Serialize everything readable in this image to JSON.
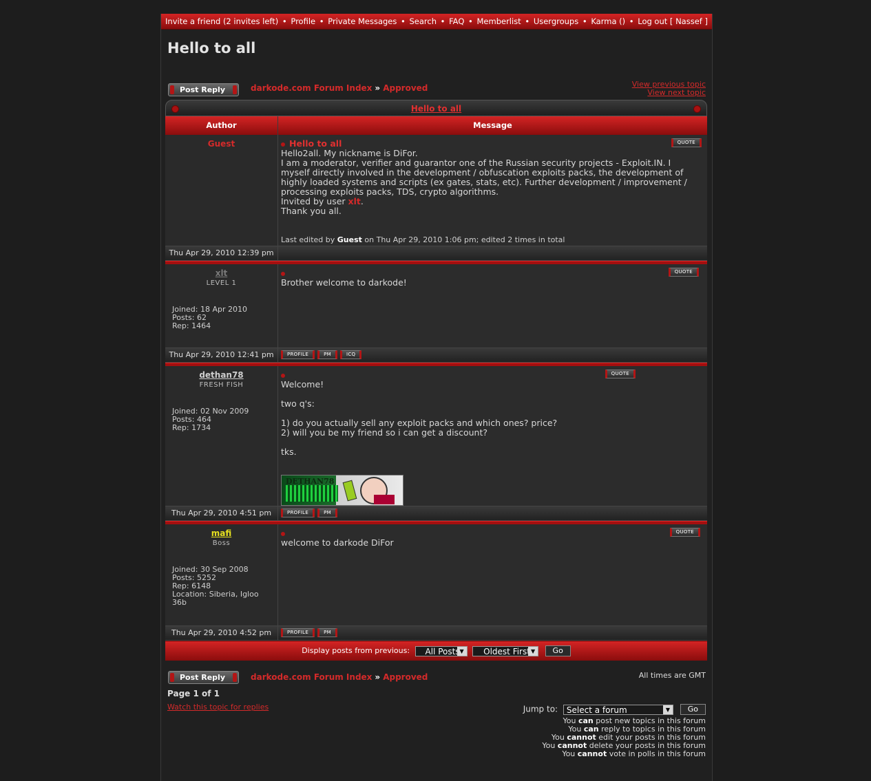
{
  "topnav": {
    "items": [
      "Invite a friend (2 invites left)",
      "Profile",
      "Private Messages",
      "Search",
      "FAQ",
      "Memberlist",
      "Usergroups",
      "Karma ()",
      "Log out"
    ],
    "separator": "•",
    "user": "[ Nassef ]"
  },
  "page_title": "Hello to all",
  "post_reply_label": "Post Reply",
  "breadcrumb": {
    "forum_index": "darkode.com Forum Index",
    "separator": "»",
    "forum": "Approved"
  },
  "topic_nav": {
    "prev": "View previous topic",
    "next": "View next topic"
  },
  "table": {
    "topic_title": "Hello to all",
    "col_author": "Author",
    "col_message": "Message"
  },
  "buttons": {
    "quote": "QUOTE",
    "profile": "PROFILE",
    "pm": "PM",
    "icq": "ICQ"
  },
  "posts": [
    {
      "author": "Guest",
      "author_color": "#d42a2a",
      "subject": "Hello to all",
      "body_lines": [
        "Hello2all. My nickname is DiFor.",
        "I am a moderator, verifier and guarantor one of the Russian security projects - Exploit.IN. I",
        "myself directly involved in the development / obfuscation exploits packs, the development of",
        "highly loaded systems and scripts (ex gates, stats, etc). Further development / improvement /",
        "processing exploits packs, TDS, crypto algorithms."
      ],
      "invited_prefix": "Invited by user ",
      "invited_user": "xlt",
      "invited_suffix": ".",
      "thanks": "Thank you all.",
      "edited_prefix": "Last edited by ",
      "edited_user": "Guest",
      "edited_suffix": " on Thu Apr 29, 2010 1:06 pm; edited 2 times in total",
      "date": "Thu Apr 29, 2010 12:39 pm"
    },
    {
      "author": "xlt",
      "author_color": "#7a7a7a",
      "rank": "LEVEL 1",
      "joined": "Joined: 18 Apr 2010",
      "posts": "Posts: 62",
      "rep": "Rep: 1464",
      "body": "Brother welcome to darkode!",
      "date": "Thu Apr 29, 2010 12:41 pm"
    },
    {
      "author": "dethan78",
      "author_color": "#cfcfcf",
      "rank": "FRESH FISH",
      "joined": "Joined: 02 Nov 2009",
      "posts": "Posts: 464",
      "rep": "Rep: 1734",
      "body_lines": [
        "Welcome!",
        "",
        "two q's:",
        "",
        "1) do you actually sell any exploit packs and which ones? price?",
        "2) will you be my friend so i can get a discount?",
        "",
        "tks."
      ],
      "signature_text": "DETHAN78",
      "date": "Thu Apr 29, 2010 4:51 pm"
    },
    {
      "author": "mafi",
      "author_color": "#e6e020",
      "rank": "Boss",
      "joined": "Joined: 30 Sep 2008",
      "posts": "Posts: 5252",
      "rep": "Rep: 6148",
      "location": "Location: Siberia, Igloo 36b",
      "body": "welcome to darkode DiFor",
      "date": "Thu Apr 29, 2010 4:52 pm"
    }
  ],
  "display_bar": {
    "label": "Display posts from previous:",
    "select_posts": "All Posts",
    "select_order": "Oldest First",
    "go": "Go"
  },
  "timezone": "All times are GMT",
  "page_of": "Page 1 of 1",
  "watch_topic": "Watch this topic for replies",
  "jump": {
    "label": "Jump to:",
    "select": "Select a forum",
    "go": "Go"
  },
  "permissions": [
    {
      "pre": "You ",
      "b": "can",
      "post": " post new topics in this forum"
    },
    {
      "pre": "You ",
      "b": "can",
      "post": " reply to topics in this forum"
    },
    {
      "pre": "You ",
      "b": "cannot",
      "post": " edit your posts in this forum"
    },
    {
      "pre": "You ",
      "b": "cannot",
      "post": " delete your posts in this forum"
    },
    {
      "pre": "You ",
      "b": "cannot",
      "post": " vote in polls in this forum"
    }
  ],
  "colors": {
    "accent_red": "#d42424",
    "link_red": "#d42a2a",
    "background": "#1d1d1d"
  }
}
